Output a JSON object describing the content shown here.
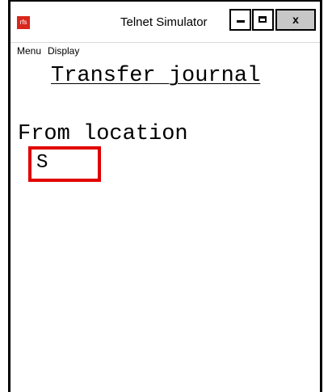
{
  "window": {
    "title": "Telnet Simulator",
    "app_icon_text": "rfs",
    "close_glyph": "x"
  },
  "menubar": {
    "items": [
      {
        "label": "Menu"
      },
      {
        "label": "Display"
      }
    ]
  },
  "screen": {
    "title": "Transfer journal",
    "field_label": "From location",
    "field_value": "S"
  },
  "colors": {
    "app_icon": "#d9261c",
    "focus_border": "#e10000",
    "close_button": "#c7c7c7"
  },
  "icons": {
    "minimize": "minimize-icon",
    "maximize": "maximize-icon",
    "close": "close-icon"
  }
}
